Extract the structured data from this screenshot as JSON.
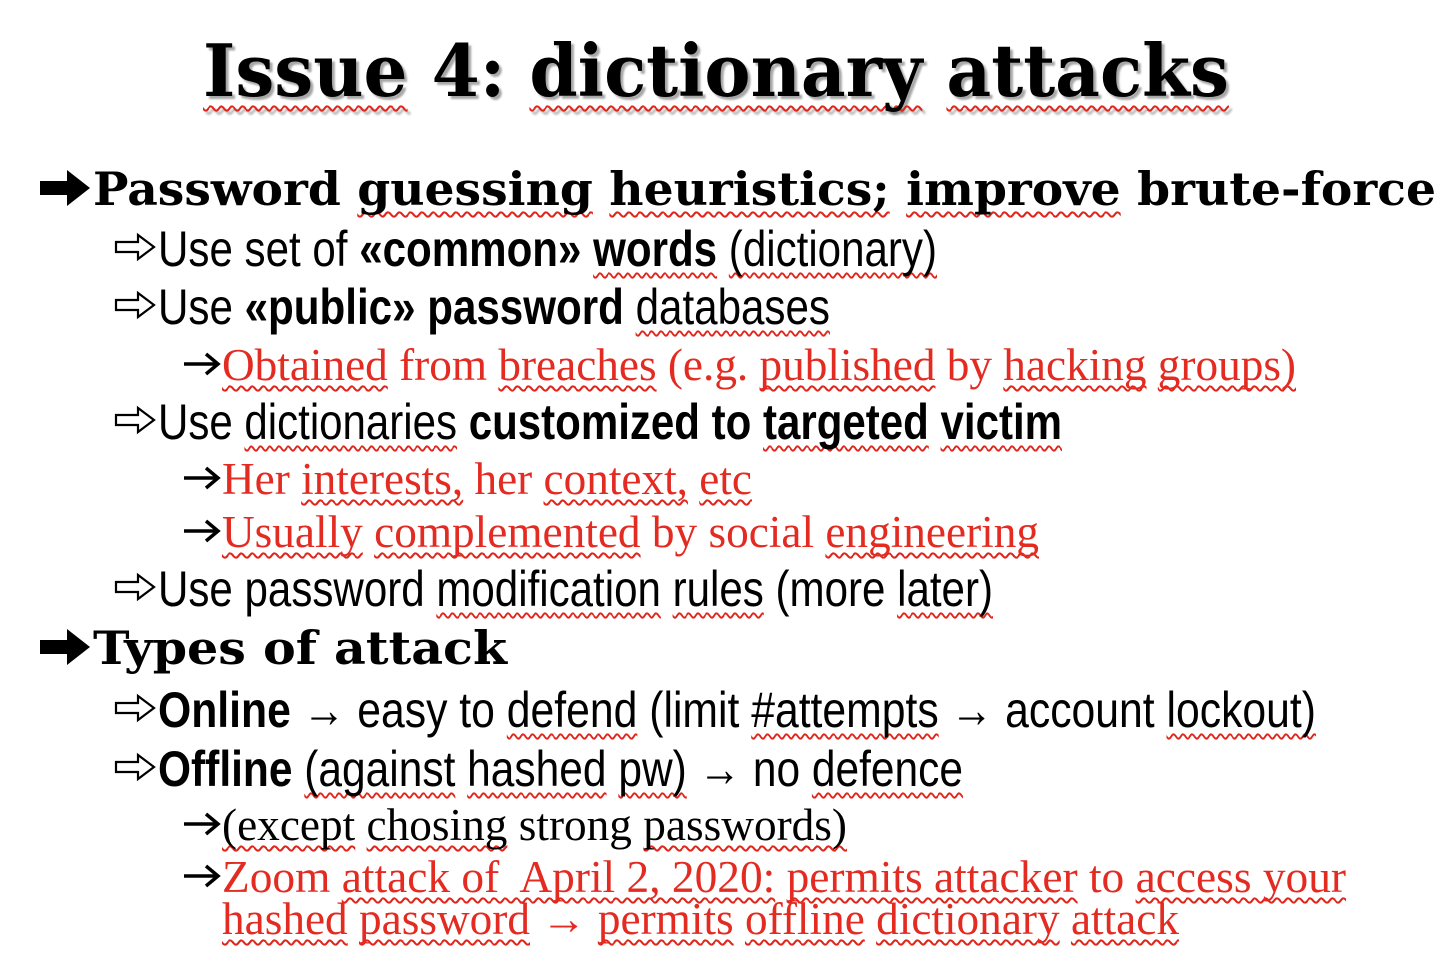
{
  "slide": {
    "colors": {
      "background": "#ffffff",
      "text": "#000000",
      "red": "#e32b22",
      "spellcheck": "#e0251b"
    },
    "title": {
      "segments": [
        {
          "text": "Issue",
          "spell": true
        },
        {
          "text": " 4: "
        },
        {
          "text": "dictionary",
          "spell": true
        },
        {
          "text": " "
        },
        {
          "text": "attacks",
          "spell": true
        }
      ]
    },
    "items": [
      {
        "bullet_icon": "heavy-arrow-icon",
        "lines": [
          [
            {
              "text": "Password "
            },
            {
              "text": "guessing",
              "spell": true
            },
            {
              "text": " "
            },
            {
              "text": "heuristics;",
              "spell": true
            },
            {
              "text": " "
            },
            {
              "text": "improve",
              "spell": true
            },
            {
              "text": " brute-force"
            }
          ]
        ]
      },
      {
        "bullet_icon": "outline-arrow-icon",
        "lines": [
          [
            {
              "text": "Use set of "
            },
            {
              "text": "«common»",
              "bold": true
            },
            {
              "text": " "
            },
            {
              "text": "words",
              "bold": true,
              "spell": true
            },
            {
              "text": " "
            },
            {
              "text": "(dictionary)",
              "spell": true
            }
          ]
        ]
      },
      {
        "bullet_icon": "outline-arrow-icon",
        "lines": [
          [
            {
              "text": "Use "
            },
            {
              "text": "«public» password",
              "bold": true
            },
            {
              "text": " "
            },
            {
              "text": "databases",
              "spell": true
            }
          ]
        ]
      },
      {
        "bullet_icon": "arrow-icon",
        "color": "#e32b22",
        "lines": [
          [
            {
              "text": "Obtained",
              "spell": true
            },
            {
              "text": " from "
            },
            {
              "text": "breaches",
              "spell": true
            },
            {
              "text": " (e.g. "
            },
            {
              "text": "published",
              "spell": true
            },
            {
              "text": " by "
            },
            {
              "text": "hacking",
              "spell": true
            },
            {
              "text": " "
            },
            {
              "text": "groups)",
              "spell": true
            }
          ]
        ]
      },
      {
        "bullet_icon": "outline-arrow-icon",
        "lines": [
          [
            {
              "text": "Use "
            },
            {
              "text": "dictionaries",
              "spell": true
            },
            {
              "text": " "
            },
            {
              "text": "customized to ",
              "bold": true
            },
            {
              "text": "targeted",
              "bold": true,
              "spell": true
            },
            {
              "text": " ",
              "bold": true
            },
            {
              "text": "victim",
              "bold": true,
              "spell": true
            }
          ]
        ]
      },
      {
        "bullet_icon": "arrow-icon",
        "color": "#e32b22",
        "lines": [
          [
            {
              "text": "Her "
            },
            {
              "text": "interests,",
              "spell": true
            },
            {
              "text": " her "
            },
            {
              "text": "context,",
              "spell": true
            },
            {
              "text": " "
            },
            {
              "text": "etc",
              "spell": true
            }
          ]
        ]
      },
      {
        "bullet_icon": "arrow-icon",
        "color": "#e32b22",
        "lines": [
          [
            {
              "text": "Usually",
              "spell": true
            },
            {
              "text": " "
            },
            {
              "text": "complemented",
              "spell": true
            },
            {
              "text": " by social "
            },
            {
              "text": "engineering",
              "spell": true
            }
          ]
        ]
      },
      {
        "bullet_icon": "outline-arrow-icon",
        "lines": [
          [
            {
              "text": "Use password "
            },
            {
              "text": "modification",
              "spell": true
            },
            {
              "text": " "
            },
            {
              "text": "rules",
              "spell": true
            },
            {
              "text": " (more "
            },
            {
              "text": "later)",
              "spell": true
            }
          ]
        ]
      },
      {
        "bullet_icon": "heavy-arrow-icon",
        "lines": [
          [
            {
              "text": "Types of attack"
            }
          ]
        ]
      },
      {
        "bullet_icon": "outline-arrow-icon",
        "lines": [
          [
            {
              "text": "Online",
              "bold": true
            },
            {
              "text": " → easy to "
            },
            {
              "text": "defend",
              "spell": true
            },
            {
              "text": " (limit "
            },
            {
              "text": "#attempts",
              "spell": true
            },
            {
              "text": " → account "
            },
            {
              "text": "lockout)",
              "spell": true
            }
          ]
        ]
      },
      {
        "bullet_icon": "outline-arrow-icon",
        "lines": [
          [
            {
              "text": "Offline",
              "bold": true
            },
            {
              "text": " "
            },
            {
              "text": "(against",
              "spell": true
            },
            {
              "text": " "
            },
            {
              "text": "hashed",
              "spell": true
            },
            {
              "text": " "
            },
            {
              "text": "pw)",
              "spell": true
            },
            {
              "text": " → no "
            },
            {
              "text": "defence",
              "spell": true
            }
          ]
        ]
      },
      {
        "bullet_icon": "arrow-icon",
        "lines": [
          [
            {
              "text": "(except",
              "spell": true
            },
            {
              "text": " "
            },
            {
              "text": "chosing",
              "spell": true
            },
            {
              "text": " strong "
            },
            {
              "text": "passwords)",
              "spell": true
            }
          ]
        ]
      },
      {
        "bullet_icon": "arrow-icon",
        "color": "#e32b22",
        "lines": [
          [
            {
              "text": "Zoom "
            },
            {
              "text": "attack of  April 2, 2020:",
              "spell": true
            },
            {
              "text": " "
            },
            {
              "text": "permits attacker",
              "spell": true
            },
            {
              "text": " to "
            },
            {
              "text": "access your",
              "spell": true
            }
          ],
          [
            {
              "text": "hashed",
              "spell": true
            },
            {
              "text": " "
            },
            {
              "text": "password",
              "spell": true
            },
            {
              "text": " → "
            },
            {
              "text": "permits",
              "spell": true
            },
            {
              "text": " "
            },
            {
              "text": "offline",
              "spell": true
            },
            {
              "text": " "
            },
            {
              "text": "dictionary",
              "spell": true
            },
            {
              "text": " "
            },
            {
              "text": "attack",
              "spell": true
            }
          ]
        ]
      }
    ]
  }
}
